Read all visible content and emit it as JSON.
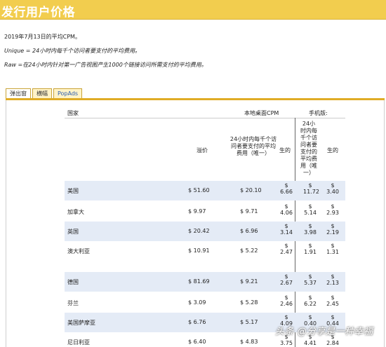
{
  "page": {
    "title": "发行用户价格",
    "info_date": "2019年7月13日的平均CPM。",
    "info_unique": "Unique = 24小时内每千个访问者要支付的平均费用。",
    "info_raw": "Raw =在24小时内针对第一广告视图产生1000个链接访问所需支付的平均费用。"
  },
  "tabs": [
    {
      "label": "弹出窗"
    },
    {
      "label": "横幅"
    },
    {
      "label": "PopAds"
    }
  ],
  "table": {
    "header_country": "国家",
    "header_desktop": "本地桌面CPM",
    "header_mobile": "手机版:",
    "sub_desktop_raw": "溢价",
    "sub_desktop_unique": "24小时内每千个访问者要支付的平均费用（唯一）",
    "sub_desktop_raw2": "生的",
    "sub_mobile_unique": "24小时内每千个访问者要支付的平均费用（唯一）",
    "sub_mobile_raw": "生的",
    "rows": [
      {
        "country": "美国",
        "a": "$ 51.60",
        "b": "$ 20.10",
        "c": "6.66",
        "d": "11.72",
        "e": "3.40"
      },
      {
        "country": "加拿大",
        "a": "$ 9.97",
        "b": "$ 9.71",
        "c": "4.06",
        "d": "5.14",
        "e": "2.93"
      },
      {
        "country": "英国",
        "a": "$ 20.42",
        "b": "$ 6.96",
        "c": "3.14",
        "d": "3.98",
        "e": "2.19"
      },
      {
        "country": "澳大利亚",
        "a": "$ 10.91",
        "b": "$ 5.22",
        "c": "2.47",
        "d": "1.91",
        "e": "1.31"
      },
      {
        "country": "德国",
        "a": "$ 81.69",
        "b": "$ 9.21",
        "c": "2.67",
        "d": "5.37",
        "e": "2.13"
      },
      {
        "country": "芬兰",
        "a": "$ 3.09",
        "b": "$ 5.28",
        "c": "2.46",
        "d": "6.22",
        "e": "2.45"
      },
      {
        "country": "美国萨摩亚",
        "a": "$ 6.76",
        "b": "$ 5.17",
        "c": "4.09",
        "d": "0.40",
        "e": "0.44"
      },
      {
        "country": "尼日利亚",
        "a": "$ 6.40",
        "b": "$ 4.83",
        "c": "3.75",
        "d": "4.41",
        "e": "2.84"
      }
    ],
    "dollar_sign": "$"
  },
  "watermark": "头条 @分享是一种幸福"
}
